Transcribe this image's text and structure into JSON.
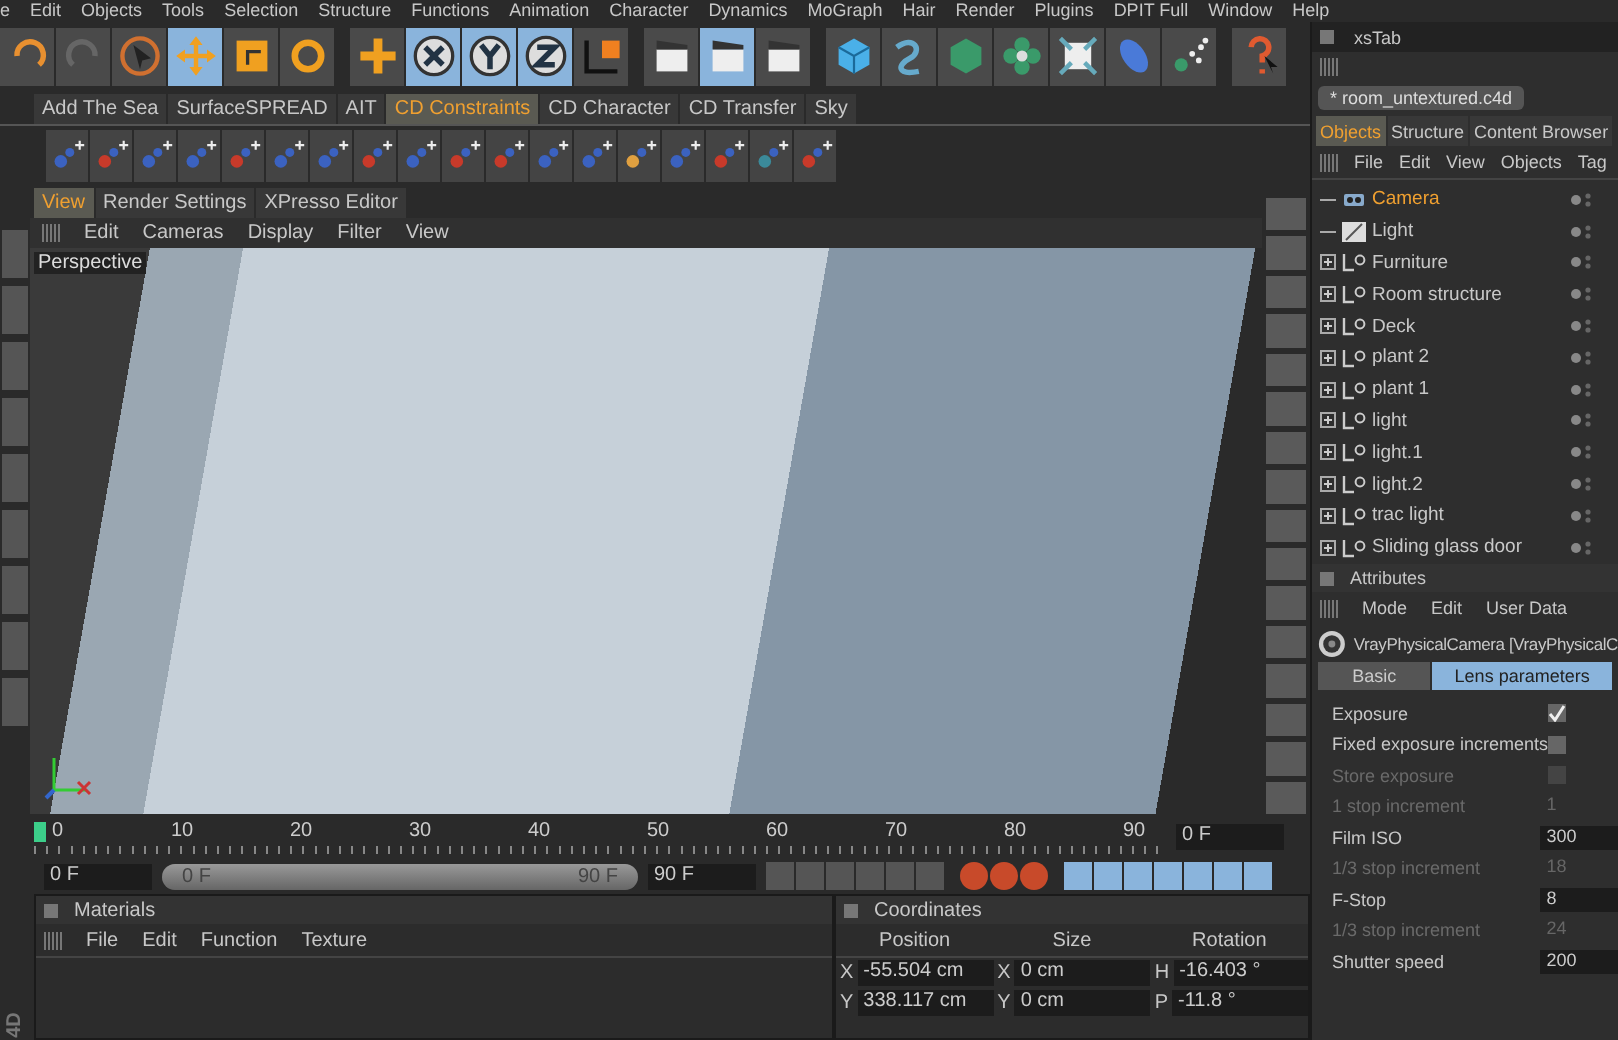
{
  "menu_bar": [
    "e",
    "Edit",
    "Objects",
    "Tools",
    "Selection",
    "Structure",
    "Functions",
    "Animation",
    "Character",
    "Dynamics",
    "MoGraph",
    "Hair",
    "Render",
    "Plugins",
    "DPIT Full",
    "Window",
    "Help"
  ],
  "toolbar": [
    {
      "kind": "undo",
      "selected": false
    },
    {
      "kind": "redo",
      "selected": false
    },
    {
      "kind": "select",
      "selected": false
    },
    {
      "kind": "move",
      "selected": true
    },
    {
      "kind": "scale",
      "selected": false
    },
    {
      "kind": "rotate",
      "selected": false
    },
    {
      "kind": "add",
      "selected": false
    },
    {
      "kind": "x",
      "selected": true
    },
    {
      "kind": "y",
      "selected": true
    },
    {
      "kind": "z",
      "selected": true
    },
    {
      "kind": "axis",
      "selected": false
    },
    {
      "kind": "render",
      "selected": false
    },
    {
      "kind": "render",
      "selected": true
    },
    {
      "kind": "render",
      "selected": false
    },
    {
      "kind": "cube",
      "selected": false
    },
    {
      "kind": "spline",
      "selected": false
    },
    {
      "kind": "box",
      "selected": false
    },
    {
      "kind": "flower",
      "selected": false
    },
    {
      "kind": "deform",
      "selected": false
    },
    {
      "kind": "capsule",
      "selected": false
    },
    {
      "kind": "particles",
      "selected": false
    },
    {
      "kind": "help",
      "selected": false
    }
  ],
  "plugin_tabs": [
    {
      "label": "Add The Sea",
      "selected": false
    },
    {
      "label": "SurfaceSPREAD",
      "selected": false
    },
    {
      "label": "AIT",
      "selected": false
    },
    {
      "label": "CD Constraints",
      "selected": true
    },
    {
      "label": "CD Character",
      "selected": false
    },
    {
      "label": "CD Transfer",
      "selected": false
    },
    {
      "label": "Sky",
      "selected": false
    }
  ],
  "view_tabs": [
    {
      "label": "View",
      "selected": true
    },
    {
      "label": "Render Settings",
      "selected": false
    },
    {
      "label": "XPresso Editor",
      "selected": false
    }
  ],
  "viewport": {
    "menu": [
      "Edit",
      "Cameras",
      "Display",
      "Filter",
      "View"
    ],
    "camera_label": "Perspective"
  },
  "timeline": {
    "ticks": [
      "0",
      "10",
      "20",
      "30",
      "40",
      "50",
      "60",
      "70",
      "80",
      "90"
    ],
    "level": 0,
    "current_frame": "0 F"
  },
  "transport": {
    "start_field": "0 F",
    "level": 1,
    "range_start": "0 F",
    "range_end": "90 F",
    "end_field": "90 F"
  },
  "side_label": "4D",
  "materials": {
    "title": "Materials",
    "menu": [
      "File",
      "Edit",
      "Function",
      "Texture"
    ]
  },
  "coordinates": {
    "title": "Coordinates",
    "columns": [
      "Position",
      "Size",
      "Rotation"
    ],
    "rows": [
      {
        "cells": [
          {
            "axis": "X",
            "value": "-55.504 cm"
          },
          {
            "axis": "X",
            "value": "0 cm"
          },
          {
            "axis": "H",
            "value": "-16.403 °"
          }
        ]
      },
      {
        "cells": [
          {
            "axis": "Y",
            "value": "338.117 cm"
          },
          {
            "axis": "Y",
            "value": "0 cm"
          },
          {
            "axis": "P",
            "value": "-11.8 °"
          }
        ]
      }
    ]
  },
  "xs_tab": {
    "title": "xsTab"
  },
  "document_tab": "* room_untextured.c4d",
  "object_manager": {
    "tabs": [
      {
        "label": "Objects",
        "selected": true
      },
      {
        "label": "Structure",
        "selected": false
      },
      {
        "label": "Content Browser",
        "selected": false
      }
    ],
    "menu": [
      "File",
      "Edit",
      "View",
      "Objects",
      "Tag"
    ],
    "objects": [
      {
        "name": "Camera",
        "kind": "camera",
        "selected": true
      },
      {
        "name": "Light",
        "kind": "light",
        "selected": false
      },
      {
        "name": "Furniture",
        "kind": "group",
        "selected": false
      },
      {
        "name": "Room structure",
        "kind": "group",
        "selected": false
      },
      {
        "name": "Deck",
        "kind": "group",
        "selected": false
      },
      {
        "name": "plant 2",
        "kind": "group",
        "selected": false
      },
      {
        "name": "plant 1",
        "kind": "group",
        "selected": false
      },
      {
        "name": "light",
        "kind": "group",
        "selected": false
      },
      {
        "name": "light.1",
        "kind": "group",
        "selected": false
      },
      {
        "name": "light.2",
        "kind": "group",
        "selected": false
      },
      {
        "name": "trac light",
        "kind": "group",
        "selected": false
      },
      {
        "name": "Sliding glass door",
        "kind": "group",
        "selected": false
      }
    ]
  },
  "attributes": {
    "title": "Attributes",
    "menu": [
      "Mode",
      "Edit",
      "User Data"
    ],
    "object": "VrayPhysicalCamera [VrayPhysicalC",
    "tabs": [
      {
        "label": "Basic",
        "selected": false
      },
      {
        "label": "Lens parameters",
        "selected": true
      }
    ],
    "fields": [
      {
        "label": "Exposure",
        "kind": "checkbox",
        "checked": true,
        "disabled": false
      },
      {
        "label": "Fixed exposure increments",
        "kind": "checkbox",
        "checked": false,
        "disabled": false
      },
      {
        "label": "Store exposure",
        "kind": "checkbox",
        "checked": false,
        "disabled": true
      },
      {
        "label": "1 stop increment",
        "kind": "number",
        "value": "1",
        "disabled": true
      },
      {
        "label": "Film ISO",
        "kind": "number",
        "value": "300",
        "disabled": false
      },
      {
        "label": "1/3 stop increment",
        "kind": "number",
        "value": "18",
        "disabled": true
      },
      {
        "label": "F-Stop",
        "kind": "number",
        "value": "8",
        "disabled": false
      },
      {
        "label": "1/3 stop increment",
        "kind": "number",
        "value": "24",
        "disabled": true
      },
      {
        "label": "Shutter speed",
        "kind": "number",
        "value": "200",
        "disabled": false
      }
    ]
  }
}
